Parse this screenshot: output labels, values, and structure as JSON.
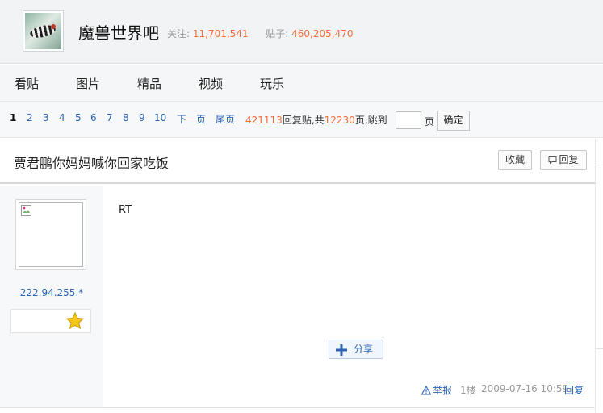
{
  "forum": {
    "name": "魔兽世界吧",
    "follow_label": "关注:",
    "follow_count": "11,701,541",
    "posts_label": "贴子:",
    "posts_count": "460,205,470"
  },
  "nav": {
    "tabs": [
      "看贴",
      "图片",
      "精品",
      "视频",
      "玩乐"
    ]
  },
  "pager": {
    "pages": [
      "1",
      "2",
      "3",
      "4",
      "5",
      "6",
      "7",
      "8",
      "9",
      "10"
    ],
    "current_page": "1",
    "next_label": "下一页",
    "last_label": "尾页",
    "reply_count": "421113",
    "reply_label": "回复贴,共",
    "total_pages": "12230",
    "pages_label": "页,",
    "jump_label": "跳到",
    "jump_page_label": "页",
    "confirm_label": "确定"
  },
  "thread": {
    "title": "贾君鹏你妈妈喊你回家吃饭",
    "collect_label": "收藏",
    "reply_label": "回复"
  },
  "post": {
    "author_ip": "222.94.255.*",
    "content": "RT",
    "share_label": "分享",
    "report_label": "举报",
    "floor": "1楼",
    "time": "2009-07-16 10:59",
    "reply_label": "回复"
  },
  "colors": {
    "link": "#2d64b3",
    "highlight": "#f56c3a",
    "star": "#f5c518"
  }
}
